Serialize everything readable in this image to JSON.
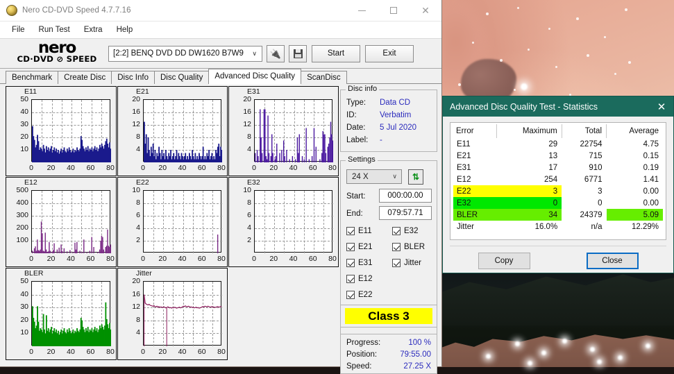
{
  "window": {
    "title": "Nero CD-DVD Speed 4.7.7.16",
    "icon": "nero-disc-icon",
    "minimize": "—",
    "maximize": "☐",
    "close": "✕"
  },
  "menubar": {
    "items": [
      "File",
      "Run Test",
      "Extra",
      "Help"
    ]
  },
  "toolbar": {
    "logo_word": "nero",
    "logo_sub": "CD·DVD ⊘ SPEED",
    "drive": "[2:2]   BENQ DVD DD DW1620 B7W9",
    "drive_chevron": "∨",
    "plugin_button": "🔌",
    "save_button": "save-icon",
    "start_label": "Start",
    "exit_label": "Exit"
  },
  "tabs": {
    "items": [
      "Benchmark",
      "Create Disc",
      "Disc Info",
      "Disc Quality",
      "Advanced Disc Quality",
      "ScanDisc"
    ],
    "active": "Advanced Disc Quality"
  },
  "disc_info": {
    "caption": "Disc info",
    "rows": [
      {
        "key": "Type:",
        "value": "Data CD"
      },
      {
        "key": "ID:",
        "value": "Verbatim"
      },
      {
        "key": "Date:",
        "value": "5 Jul 2020"
      },
      {
        "key": "Label:",
        "value": "-"
      }
    ]
  },
  "settings": {
    "caption": "Settings",
    "speed": "24 X",
    "speed_chevron": "∨",
    "refresh_icon": "refresh-icon",
    "start_label": "Start:",
    "start_value": "000:00.00",
    "end_label": "End:",
    "end_value": "079:57.71",
    "checkboxes_left": [
      "E11",
      "E21",
      "E31",
      "E12",
      "E22"
    ],
    "checkboxes_right": [
      "E32",
      "BLER",
      "Jitter"
    ]
  },
  "quality": {
    "class_label": "Class 3"
  },
  "progress": {
    "rows": [
      {
        "key": "Progress:",
        "value": "100 %"
      },
      {
        "key": "Position:",
        "value": "79:55.00"
      },
      {
        "key": "Speed:",
        "value": "27.25 X"
      }
    ]
  },
  "stats_dialog": {
    "title": "Advanced Disc Quality Test - Statistics",
    "close_icon": "✕",
    "headers": [
      "Error",
      "Maximum",
      "Total",
      "Average"
    ],
    "rows": [
      {
        "error": "E11",
        "maximum": "29",
        "total": "22754",
        "average": "4.75",
        "hl_row": "none",
        "hl_avg": "none"
      },
      {
        "error": "E21",
        "maximum": "13",
        "total": "715",
        "average": "0.15",
        "hl_row": "none",
        "hl_avg": "none"
      },
      {
        "error": "E31",
        "maximum": "17",
        "total": "910",
        "average": "0.19",
        "hl_row": "none",
        "hl_avg": "none"
      },
      {
        "error": "E12",
        "maximum": "254",
        "total": "6771",
        "average": "1.41",
        "hl_row": "none",
        "hl_avg": "none"
      },
      {
        "error": "E22",
        "maximum": "3",
        "total": "3",
        "average": "0.00",
        "hl_row": "yellow",
        "hl_avg": "none"
      },
      {
        "error": "E32",
        "maximum": "0",
        "total": "0",
        "average": "0.00",
        "hl_row": "green",
        "hl_avg": "none"
      },
      {
        "error": "BLER",
        "maximum": "34",
        "total": "24379",
        "average": "5.09",
        "hl_row": "ltgreen",
        "hl_avg": "ltgreen"
      },
      {
        "error": "Jitter",
        "maximum": "16.0%",
        "total": "n/a",
        "average": "12.29%",
        "hl_row": "none",
        "hl_avg": "none"
      }
    ],
    "copy_label": "Copy",
    "close_label": "Close",
    "colors": {
      "titlebar": "#1b6b5d",
      "yellow": "#ffff00",
      "green": "#00e800",
      "ltgreen": "#66ee00"
    }
  },
  "chart_data": [
    {
      "type": "bar",
      "title": "E11",
      "xlabel": "",
      "ylabel": "",
      "color": "#1a1a8c",
      "filled": true,
      "xlim": [
        0,
        80
      ],
      "ylim": [
        0,
        50
      ],
      "xticks": [
        0,
        20,
        40,
        60,
        80
      ],
      "yticks": [
        10,
        20,
        30,
        40,
        50
      ],
      "grid": true,
      "values": [
        29,
        21,
        18,
        12,
        14,
        22,
        17,
        10,
        12,
        11,
        9,
        14,
        11,
        8,
        13,
        10,
        12,
        9,
        11,
        13,
        8,
        10,
        12,
        9,
        11,
        8,
        10,
        7,
        9,
        11,
        8,
        10,
        12,
        9,
        8,
        11,
        9,
        12,
        10,
        8,
        9,
        11,
        8,
        10,
        9,
        12,
        10,
        9,
        11,
        21,
        18,
        13,
        11,
        9,
        12,
        10,
        13,
        9,
        11,
        10,
        12,
        9,
        11,
        13,
        10,
        12,
        9,
        11,
        14,
        12,
        15,
        13,
        11,
        14,
        17,
        19,
        15,
        12,
        16,
        11
      ]
    },
    {
      "type": "bar",
      "title": "E21",
      "xlabel": "",
      "ylabel": "",
      "color": "#1a1a8c",
      "filled": true,
      "xlim": [
        0,
        80
      ],
      "ylim": [
        0,
        20
      ],
      "xticks": [
        0,
        20,
        40,
        60,
        80
      ],
      "yticks": [
        4,
        8,
        12,
        16,
        20
      ],
      "grid": true,
      "values": [
        13,
        6,
        9,
        3,
        8,
        4,
        2,
        5,
        3,
        6,
        2,
        4,
        1,
        3,
        2,
        5,
        3,
        1,
        4,
        2,
        3,
        1,
        4,
        2,
        1,
        3,
        2,
        4,
        1,
        2,
        3,
        1,
        2,
        4,
        1,
        3,
        2,
        1,
        3,
        2,
        1,
        2,
        3,
        1,
        2,
        1,
        3,
        2,
        1,
        4,
        2,
        1,
        3,
        1,
        2,
        1,
        3,
        2,
        1,
        2,
        5,
        1,
        2,
        1,
        3,
        2,
        4,
        1,
        2,
        3,
        1,
        2,
        1,
        4,
        3,
        5,
        6,
        2,
        5,
        4
      ]
    },
    {
      "type": "bar",
      "title": "E31",
      "xlabel": "",
      "ylabel": "",
      "color": "#4b19a0",
      "filled": false,
      "xlim": [
        0,
        80
      ],
      "ylim": [
        0,
        20
      ],
      "xticks": [
        0,
        20,
        40,
        60,
        80
      ],
      "yticks": [
        4,
        8,
        12,
        16,
        20
      ],
      "grid": true,
      "values": [
        3,
        0,
        4,
        2,
        0,
        17,
        8,
        3,
        0,
        17,
        17,
        2,
        1,
        15,
        3,
        0,
        2,
        9,
        3,
        0,
        1,
        2,
        6,
        0,
        0,
        3,
        0,
        4,
        0,
        7,
        2,
        0,
        4,
        0,
        0,
        1,
        0,
        0,
        2,
        0,
        0,
        1,
        0,
        8,
        3,
        9,
        0,
        0,
        2,
        0,
        1,
        0,
        11,
        0,
        0,
        1,
        0,
        0,
        2,
        0,
        11,
        0,
        5,
        0,
        0,
        0,
        1,
        0,
        3,
        10,
        9,
        9,
        3,
        0,
        5,
        6,
        8,
        13,
        9,
        7
      ]
    },
    {
      "type": "bar",
      "title": "E12",
      "xlabel": "",
      "ylabel": "",
      "color": "#7b2a86",
      "filled": false,
      "xlim": [
        0,
        80
      ],
      "ylim": [
        0,
        500
      ],
      "xticks": [
        0,
        20,
        40,
        60,
        80
      ],
      "yticks": [
        100,
        200,
        300,
        400,
        500
      ],
      "grid": true,
      "values": [
        20,
        0,
        40,
        55,
        20,
        110,
        25,
        20,
        30,
        254,
        160,
        20,
        15,
        165,
        30,
        10,
        15,
        90,
        20,
        0,
        10,
        25,
        80,
        0,
        0,
        30,
        0,
        45,
        0,
        70,
        20,
        0,
        40,
        0,
        0,
        15,
        0,
        0,
        25,
        0,
        0,
        10,
        0,
        85,
        30,
        90,
        0,
        0,
        20,
        0,
        10,
        0,
        110,
        0,
        0,
        10,
        0,
        0,
        20,
        0,
        130,
        0,
        50,
        0,
        0,
        0,
        10,
        0,
        30,
        100,
        140,
        130,
        30,
        0,
        50,
        60,
        190,
        60,
        50,
        70
      ]
    },
    {
      "type": "bar",
      "title": "E22",
      "xlabel": "",
      "ylabel": "",
      "color": "#7b2a86",
      "filled": false,
      "xlim": [
        0,
        80
      ],
      "ylim": [
        0,
        10
      ],
      "xticks": [
        0,
        20,
        40,
        60,
        80
      ],
      "yticks": [
        2,
        4,
        6,
        8,
        10
      ],
      "grid": true,
      "values": [
        0,
        0,
        0,
        0,
        0,
        0,
        0,
        0,
        0,
        0,
        0,
        0,
        0,
        0,
        0,
        0,
        0,
        0,
        0,
        0,
        0,
        0,
        0,
        0,
        0,
        0,
        0,
        0,
        0,
        0,
        0,
        0,
        0,
        0,
        0,
        0,
        0,
        0,
        0,
        0,
        0,
        0,
        0,
        0,
        0,
        0,
        0,
        0,
        0,
        0,
        0,
        0,
        0,
        0,
        0,
        0,
        0,
        0,
        0,
        0,
        0,
        0,
        0,
        0,
        0,
        0,
        0,
        0,
        0,
        0,
        0,
        0,
        0,
        0,
        0,
        3,
        0,
        0,
        0,
        0
      ]
    },
    {
      "type": "bar",
      "title": "E32",
      "xlabel": "",
      "ylabel": "",
      "color": "#7b2a86",
      "filled": false,
      "xlim": [
        0,
        80
      ],
      "ylim": [
        0,
        10
      ],
      "xticks": [
        0,
        20,
        40,
        60,
        80
      ],
      "yticks": [
        2,
        4,
        6,
        8,
        10
      ],
      "grid": true,
      "values": [
        0,
        0,
        0,
        0,
        0,
        0,
        0,
        0,
        0,
        0,
        0,
        0,
        0,
        0,
        0,
        0,
        0,
        0,
        0,
        0,
        0,
        0,
        0,
        0,
        0,
        0,
        0,
        0,
        0,
        0,
        0,
        0,
        0,
        0,
        0,
        0,
        0,
        0,
        0,
        0,
        0,
        0,
        0,
        0,
        0,
        0,
        0,
        0,
        0,
        0,
        0,
        0,
        0,
        0,
        0,
        0,
        0,
        0,
        0,
        0,
        0,
        0,
        0,
        0,
        0,
        0,
        0,
        0,
        0,
        0,
        0,
        0,
        0,
        0,
        0,
        0,
        0,
        0,
        0,
        0
      ]
    },
    {
      "type": "bar",
      "title": "BLER",
      "xlabel": "",
      "ylabel": "",
      "color": "#009000",
      "filled": true,
      "xlim": [
        0,
        80
      ],
      "ylim": [
        0,
        50
      ],
      "xticks": [
        0,
        20,
        40,
        60,
        80
      ],
      "yticks": [
        10,
        20,
        30,
        40,
        50
      ],
      "grid": true,
      "values": [
        31,
        22,
        19,
        14,
        16,
        31,
        19,
        12,
        14,
        13,
        11,
        25,
        13,
        10,
        24,
        12,
        14,
        11,
        13,
        15,
        10,
        12,
        14,
        11,
        13,
        10,
        12,
        9,
        11,
        13,
        10,
        12,
        14,
        11,
        10,
        13,
        11,
        14,
        12,
        10,
        11,
        13,
        10,
        12,
        11,
        14,
        12,
        11,
        13,
        22,
        20,
        15,
        13,
        11,
        14,
        12,
        15,
        11,
        13,
        12,
        14,
        11,
        13,
        15,
        12,
        14,
        11,
        13,
        16,
        14,
        17,
        15,
        13,
        16,
        34,
        21,
        17,
        14,
        18,
        13
      ]
    },
    {
      "type": "line",
      "title": "Jitter",
      "xlabel": "",
      "ylabel": "",
      "color": "#8b1a5a",
      "filled": false,
      "xlim": [
        0,
        80
      ],
      "ylim": [
        0,
        20
      ],
      "xticks": [
        0,
        20,
        40,
        60,
        80
      ],
      "yticks": [
        4,
        8,
        12,
        16,
        20
      ],
      "grid": true,
      "values": [
        16.0,
        13.4,
        13.1,
        12.9,
        12.8,
        13.0,
        12.7,
        12.6,
        12.5,
        12.4,
        12.6,
        12.3,
        12.2,
        12.4,
        12.1,
        12.3,
        12.0,
        12.2,
        12.1,
        12.0,
        12.2,
        12.1,
        11.9,
        12.0,
        12.2,
        12.1,
        11.9,
        12.0,
        11.8,
        12.0,
        11.9,
        12.1,
        12.0,
        11.8,
        11.9,
        12.0,
        12.1,
        11.9,
        12.0,
        12.2,
        12.4,
        12.3,
        12.5,
        12.3,
        12.2,
        12.4,
        12.3,
        12.1,
        12.2,
        12.0,
        12.1,
        11.9,
        12.0,
        12.1,
        11.9,
        12.0,
        11.8,
        11.9,
        12.0,
        12.2,
        12.3,
        12.2,
        12.4,
        12.3,
        12.2,
        12.4,
        12.3,
        12.1,
        12.2,
        12.3,
        12.1,
        12.2,
        12.0,
        12.1,
        12.2,
        12.3,
        12.1,
        12.2,
        12.3,
        12.2
      ]
    }
  ]
}
